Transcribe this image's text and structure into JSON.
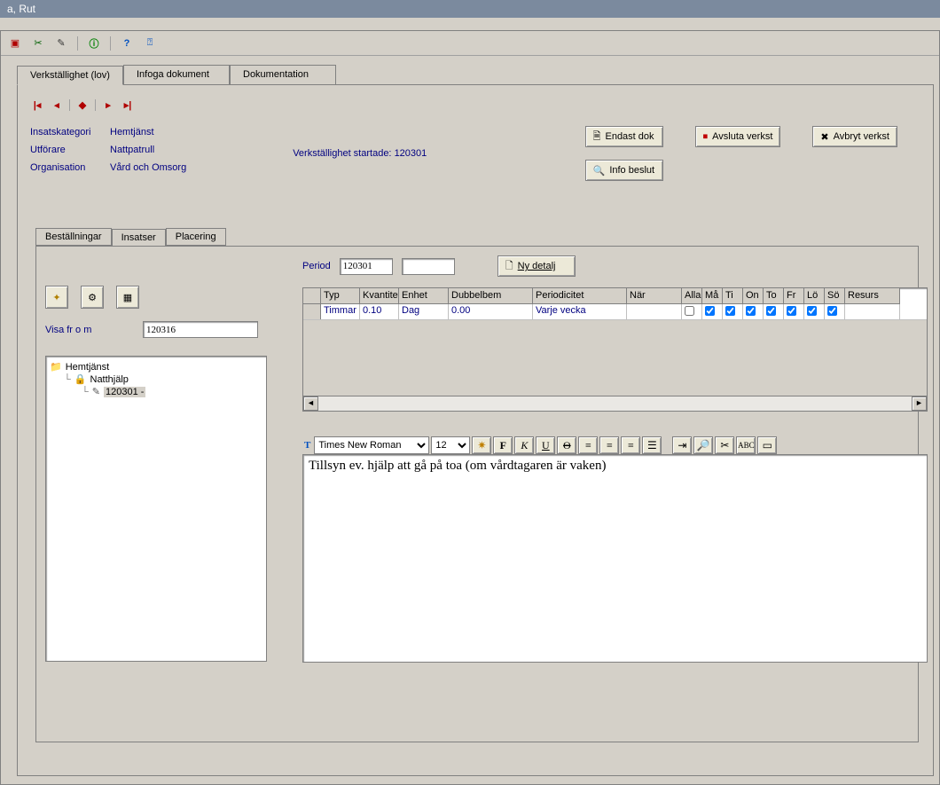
{
  "window": {
    "title": "a, Rut"
  },
  "tabs": {
    "main": [
      "Verkställighet (lov)",
      "Infoga dokument",
      "Dokumentation"
    ],
    "active_main": 0,
    "sub": [
      "Beställningar",
      "Insatser",
      "Placering"
    ],
    "active_sub": 1
  },
  "info": {
    "kategori_label": "Insatskategori",
    "kategori_value": "Hemtjänst",
    "utforare_label": "Utförare",
    "utforare_value": "Nattpatrull",
    "org_label": "Organisation",
    "org_value": "Vård och Omsorg",
    "started_label": "Verkställighet startade:",
    "started_value": "120301"
  },
  "buttons": {
    "endast_dok": "Endast dok",
    "avsluta": "Avsluta verkst",
    "avbryt": "Avbryt verkst",
    "info_beslut": "Info beslut",
    "ny_detalj": "Ny detalj"
  },
  "period": {
    "label": "Period",
    "from": "120301",
    "to": ""
  },
  "visa": {
    "label": "Visa fr o m",
    "value": "120316"
  },
  "tree": {
    "root": "Hemtjänst",
    "child": "Natthjälp",
    "leaf": "120301 -"
  },
  "grid": {
    "headers": {
      "typ": "Typ",
      "kvantitet": "Kvantitet",
      "enhet": "Enhet",
      "dubbelbem": "Dubbelbem",
      "periodicitet": "Periodicitet",
      "nar": "När",
      "alla": "Alla",
      "ma": "Må",
      "ti": "Ti",
      "on": "On",
      "to": "To",
      "fr": "Fr",
      "lo": "Lö",
      "so": "Sö",
      "resurs": "Resurs"
    },
    "row": {
      "typ": "Timmar",
      "kvantitet": "0.10",
      "enhet": "Dag",
      "dubbelbem": "0.00",
      "periodicitet": "Varje vecka",
      "nar": "",
      "alla": false,
      "ma": true,
      "ti": true,
      "on": true,
      "to": true,
      "fr": true,
      "lo": true,
      "so": true,
      "resurs": ""
    }
  },
  "editor": {
    "font": "Times New Roman",
    "size": "12",
    "text": "Tillsyn ev. hjälp att gå på toa (om vårdtagaren är vaken)"
  }
}
